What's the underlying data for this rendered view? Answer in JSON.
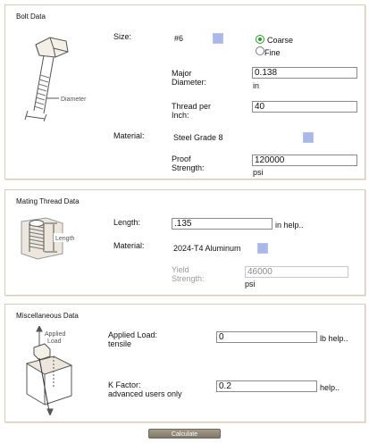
{
  "bolt": {
    "title": "Bolt Data",
    "diagram_label": "Diameter",
    "size_label": "Size:",
    "size_value": "#6",
    "coarse_label": "Coarse",
    "fine_label": "Fine",
    "major_label_1": "Major",
    "major_label_2": "Diameter:",
    "major_value": "0.138",
    "major_unit": "in",
    "thread_label_1": "Thread per",
    "thread_label_2": "Inch:",
    "thread_value": "40",
    "material_label": "Material:",
    "material_value": "Steel Grade 8",
    "proof_label_1": "Proof",
    "proof_label_2": "Strength:",
    "proof_value": "120000",
    "proof_unit": "psi"
  },
  "mating": {
    "title": "Mating Thread Data",
    "diagram_label": "Length",
    "length_label": "Length:",
    "length_value": ".135",
    "length_unit": "in help..",
    "material_label": "Material:",
    "material_value": "2024-T4 Aluminum",
    "yield_label_1": "Yield",
    "yield_label_2": "Strength:",
    "yield_value": "46000",
    "yield_unit": "psi"
  },
  "misc": {
    "title": "Miscellaneous Data",
    "diagram_label_1": "Applied",
    "diagram_label_2": "Load",
    "load_label_1": "Applied Load:",
    "load_label_2": "tensile",
    "load_value": "0",
    "load_unit": "lb help..",
    "k_label_1": "K Factor:",
    "k_label_2": "advanced users only",
    "k_value": "0.2",
    "k_help": "help.."
  },
  "calculate_label": "Calculate",
  "colors": {
    "border": "#d8cdbb",
    "dropdown_square": "#a9b8e8",
    "radio_selected": "#2e9b2e",
    "button": "#8f8778"
  },
  "icons": [
    "bolt-diagram-icon",
    "thread-length-diagram-icon",
    "applied-load-diagram-icon",
    "dropdown-icon",
    "radio-icon"
  ]
}
